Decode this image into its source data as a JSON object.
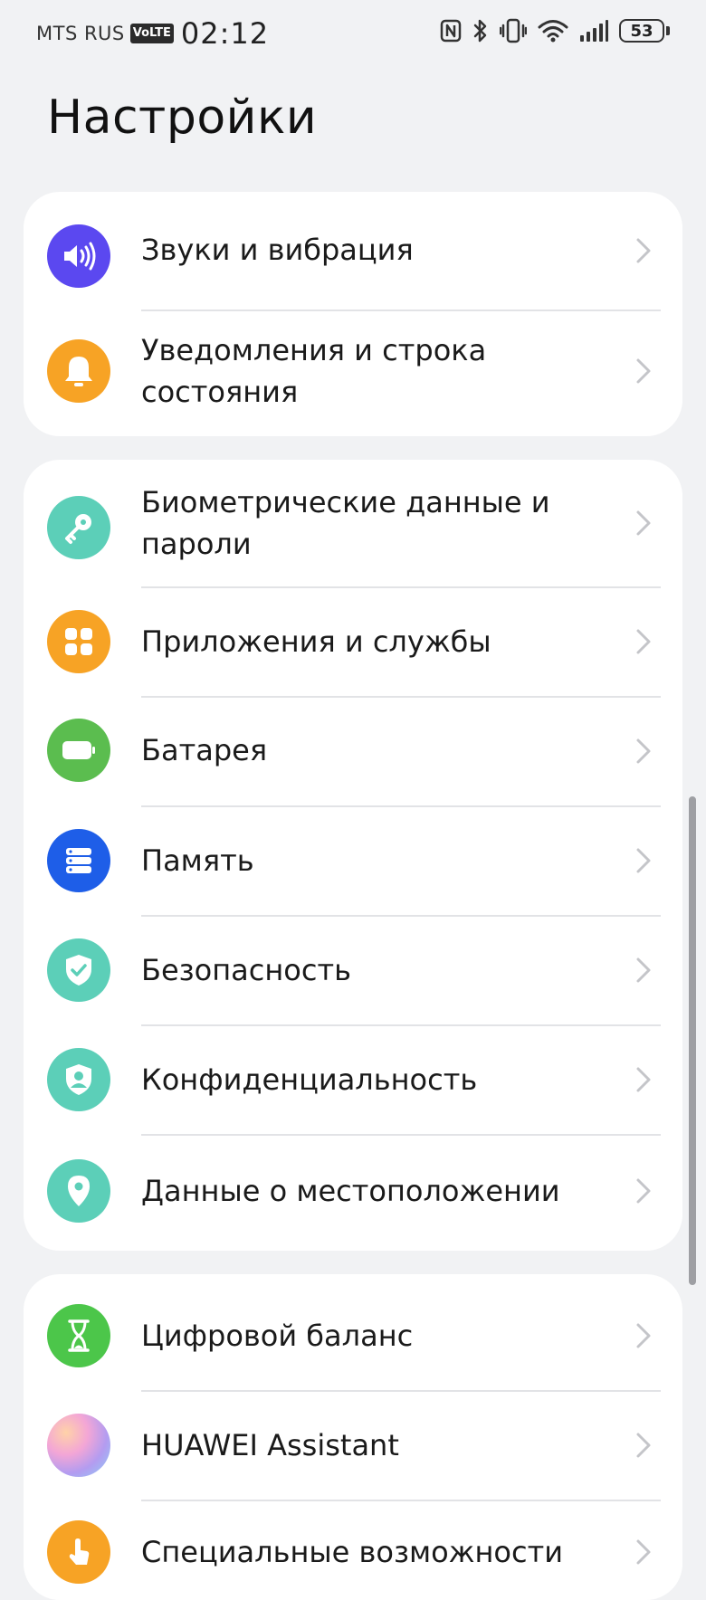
{
  "status_bar": {
    "carrier": "MTS RUS",
    "volte": "VoLTE",
    "time": "02:12",
    "battery": "53",
    "icons": [
      "nfc-icon",
      "bluetooth-icon",
      "vibrate-icon",
      "wifi-icon",
      "signal-icon",
      "battery-icon"
    ]
  },
  "title": "Настройки",
  "cards": [
    {
      "items": [
        {
          "label_lines": [
            "Звуки и вибрация"
          ],
          "icon": "sound-icon",
          "color": "#5b48f0"
        },
        {
          "label_lines": [
            "Уведомления и строка",
            "состояния"
          ],
          "icon": "bell-icon",
          "color": "#f7a325"
        }
      ]
    },
    {
      "items": [
        {
          "label_lines": [
            "Биометрические данные и",
            "пароли"
          ],
          "icon": "key-icon",
          "color": "#5ccfb8"
        },
        {
          "label_lines": [
            "Приложения и службы"
          ],
          "icon": "apps-icon",
          "color": "#f7a325"
        },
        {
          "label_lines": [
            "Батарея"
          ],
          "icon": "battery-settings-icon",
          "color": "#5bbd4f"
        },
        {
          "label_lines": [
            "Память"
          ],
          "icon": "storage-icon",
          "color": "#1e5ee8"
        },
        {
          "label_lines": [
            "Безопасность"
          ],
          "icon": "shield-check-icon",
          "color": "#5ccfb8"
        },
        {
          "label_lines": [
            "Конфиденциальность"
          ],
          "icon": "privacy-icon",
          "color": "#5ccfb8"
        },
        {
          "label_lines": [
            "Данные о местоположении"
          ],
          "icon": "location-pin-icon",
          "color": "#5ccfb8"
        }
      ]
    },
    {
      "items": [
        {
          "label_lines": [
            "Цифровой баланс"
          ],
          "icon": "hourglass-icon",
          "color": "#4cc64a"
        },
        {
          "label_lines": [
            "HUAWEI Assistant"
          ],
          "icon": "huawei-assistant-icon",
          "color": "#c9a8e8"
        },
        {
          "label_lines": [
            "Специальные возможности"
          ],
          "icon": "hand-icon",
          "color": "#f7a325"
        }
      ]
    }
  ]
}
